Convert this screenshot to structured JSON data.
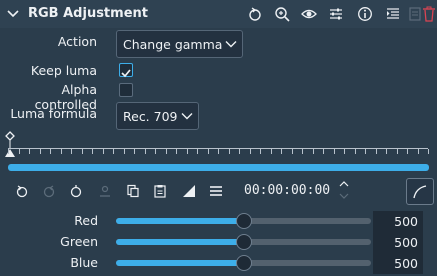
{
  "header": {
    "title": "RGB Adjustment",
    "icons": [
      "collapse-icon",
      "reset-icon",
      "zoom-icon",
      "eye-icon",
      "sliders-icon",
      "info-icon",
      "align-icon",
      "save-icon",
      "delete-icon"
    ]
  },
  "params": {
    "action_label": "Action",
    "action_value": "Change gamma",
    "keep_luma_label": "Keep luma",
    "keep_luma_checked": true,
    "alpha_label": "Alpha controlled",
    "alpha_checked": false,
    "luma_formula_label": "Luma formula",
    "luma_formula_value": "Rec. 709"
  },
  "keyframes": {
    "timecode": "00:00:00:00",
    "toolbar_icons": [
      "undo-icon",
      "redo-icon",
      "keyframe-icon",
      "copy-icon",
      "paste-icon",
      "ramp-icon",
      "menu-icon",
      "curve-icon"
    ]
  },
  "sliders": [
    {
      "label": "Red",
      "value": "500",
      "level": 0.5
    },
    {
      "label": "Green",
      "value": "500",
      "level": 0.5
    },
    {
      "label": "Blue",
      "value": "500",
      "level": 0.5
    }
  ],
  "colors": {
    "accent": "#3daee9",
    "background": "#2b3d4c",
    "delete": "#da4453"
  }
}
